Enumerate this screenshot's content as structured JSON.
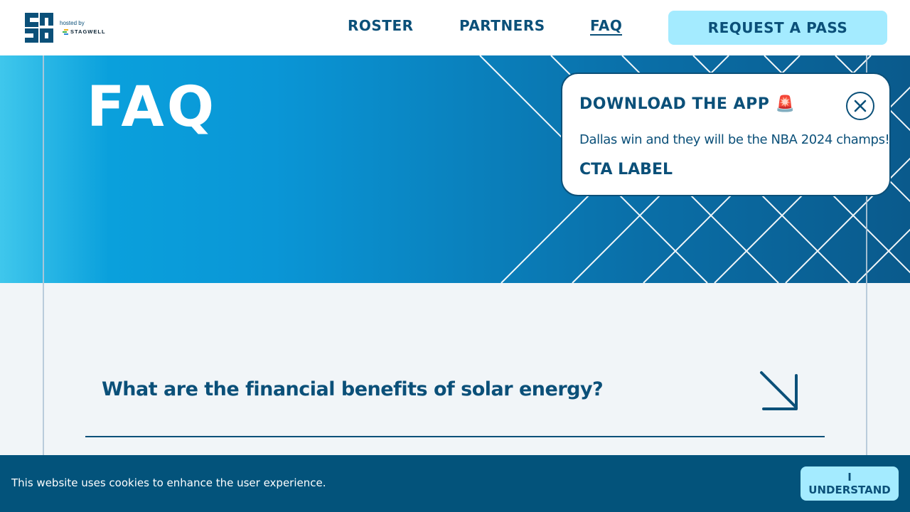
{
  "brand": {
    "logo_text": "SB",
    "hosted_by": "hosted by",
    "host_name": "STAGWELL"
  },
  "nav": {
    "items": [
      {
        "label": "ROSTER",
        "active": false
      },
      {
        "label": "PARTNERS",
        "active": false
      },
      {
        "label": "FAQ",
        "active": true
      }
    ],
    "cta_label": "REQUEST A PASS"
  },
  "hero": {
    "title": "FAQ"
  },
  "popup": {
    "title": "DOWNLOAD THE APP",
    "emoji": "🚨",
    "message": "Dallas win and they will be the NBA 2024 champs!",
    "cta_label": "CTA LABEL",
    "close_icon": "close-icon"
  },
  "faq": {
    "items": [
      {
        "question": "What are the financial benefits of solar energy?",
        "icon": "arrow-down-right-icon"
      }
    ]
  },
  "cookie_bar": {
    "message": "This website uses cookies to enhance the user experience.",
    "button_label": "I UNDERSTAND"
  },
  "colors": {
    "primary": "#0b5079",
    "accent": "#a4ebff",
    "cookie_bg": "#03537b",
    "page_bg": "#f1f5f8"
  }
}
